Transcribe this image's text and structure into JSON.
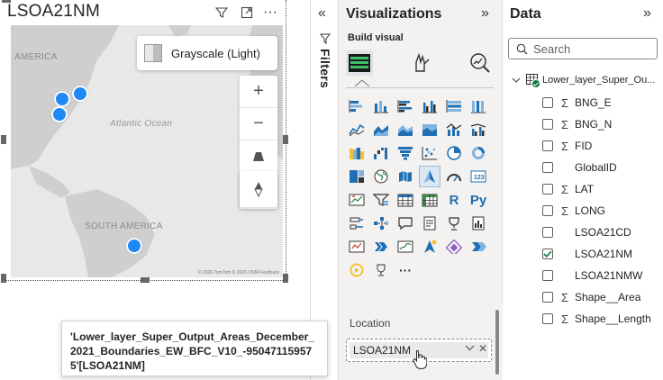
{
  "visual": {
    "title": "LSOA21NM",
    "map": {
      "labels": {
        "north_america": "AMERICA",
        "atlantic": "Atlantic Ocean",
        "south_america": "SOUTH AMERICA"
      },
      "style_button": "Grayscale (Light)",
      "copyright": "© 2026 TomTom  © 2026 OSM  Feedback"
    }
  },
  "tooltip": {
    "text": "'Lower_layer_Super_Output_Areas_December_2021_Boundaries_EW_BFC_V10_-950471159575'[LSOA21NM]"
  },
  "filters": {
    "label": "Filters"
  },
  "visualizations": {
    "title": "Visualizations",
    "build_label": "Build visual",
    "field_well_label": "Location",
    "field_well_value": "LSOA21NM",
    "icons": [
      "stacked-bar-chart",
      "stacked-column-chart",
      "clustered-bar-chart",
      "clustered-column-chart",
      "100-stacked-bar-chart",
      "100-stacked-column-chart",
      "line-chart",
      "area-chart",
      "stacked-area-chart",
      "100-stacked-area-chart",
      "line-column-chart",
      "line-clustered-column-chart",
      "ribbon-chart",
      "waterfall-chart",
      "funnel-chart",
      "scatter-chart",
      "pie-chart",
      "donut-chart",
      "treemap",
      "map",
      "filled-map",
      "azure-map",
      "gauge",
      "card",
      "kpi",
      "slicer",
      "table",
      "matrix",
      "r-visual",
      "python-visual",
      "key-influencers",
      "decomposition-tree",
      "qa-visual",
      "smart-narrative",
      "metrics-visual",
      "paginated-report",
      "power-apps",
      "power-automate",
      "arcgis",
      "azure-map-2",
      "get-more-visuals",
      "more-options",
      "narrative",
      "trophy",
      "more"
    ],
    "r_glyph": "R",
    "py_glyph": "Py",
    "ellipsis": "···"
  },
  "data_pane": {
    "title": "Data",
    "search_placeholder": "Search",
    "table_name": "Lower_layer_Super_Ou...",
    "fields": [
      {
        "name": "BNG_E",
        "sigma": true,
        "checked": false
      },
      {
        "name": "BNG_N",
        "sigma": true,
        "checked": false
      },
      {
        "name": "FID",
        "sigma": true,
        "checked": false
      },
      {
        "name": "GlobalID",
        "sigma": false,
        "checked": false
      },
      {
        "name": "LAT",
        "sigma": true,
        "checked": false
      },
      {
        "name": "LONG",
        "sigma": true,
        "checked": false
      },
      {
        "name": "LSOA21CD",
        "sigma": false,
        "checked": false
      },
      {
        "name": "LSOA21NM",
        "sigma": false,
        "checked": true
      },
      {
        "name": "LSOA21NMW",
        "sigma": false,
        "checked": false
      },
      {
        "name": "Shape__Area",
        "sigma": true,
        "checked": false
      },
      {
        "name": "Shape__Length",
        "sigma": true,
        "checked": false
      }
    ]
  },
  "colors": {
    "accent": "#1e88f5",
    "pane_bg": "#f3f2f1",
    "check_green": "#107c41",
    "viz_blue": "#1f6fb2"
  }
}
